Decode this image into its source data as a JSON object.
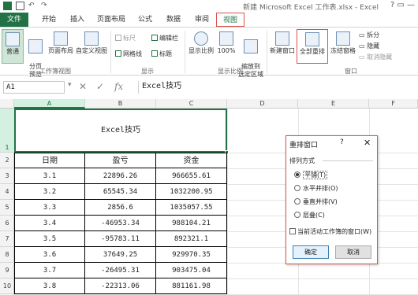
{
  "app": {
    "window_title": "新建 Microsoft Excel 工作表.xlsx - Excel",
    "window_controls": "?  ▭  —"
  },
  "tabs": [
    "文件",
    "开始",
    "插入",
    "页面布局",
    "公式",
    "数据",
    "审阅",
    "视图"
  ],
  "ribbon": {
    "workbook_views": {
      "normal": "普通",
      "page_break": "分页\n预览",
      "page_layout": "页面布局",
      "custom_views": "自定义视图",
      "label": "工作簿视图"
    },
    "show": {
      "ruler": "标尺",
      "formula_bar": "编辑栏",
      "gridlines": "网格线",
      "headings": "标题",
      "label": "显示"
    },
    "zoom": {
      "zoom": "显示比例",
      "zoom100": "100%",
      "zoom_selection": "缩放到\n选定区域",
      "label": "显示比例"
    },
    "window": {
      "new_window": "新建窗口",
      "arrange_all": "全部重排",
      "freeze_panes": "冻结窗格",
      "split": "拆分",
      "hide": "隐藏",
      "unhide": "取消隐藏",
      "label": "窗口"
    }
  },
  "formula_bar": {
    "name_box": "A1",
    "fx": "fx",
    "value": "Excel技巧"
  },
  "grid": {
    "columns": [
      "A",
      "B",
      "C",
      "D",
      "E",
      "F"
    ],
    "rows": [
      "1",
      "2",
      "3",
      "4",
      "5",
      "6",
      "7",
      "8",
      "9",
      "10"
    ],
    "title_cell": "Excel技巧",
    "headers": [
      "日期",
      "盈亏",
      "资金"
    ],
    "data": [
      [
        "3.1",
        "22896.26",
        "966655.61"
      ],
      [
        "3.2",
        "65545.34",
        "1032200.95"
      ],
      [
        "3.3",
        "2856.6",
        "1035057.55"
      ],
      [
        "3.4",
        "-46953.34",
        "988104.21"
      ],
      [
        "3.5",
        "-95783.11",
        "892321.1"
      ],
      [
        "3.6",
        "37649.25",
        "929970.35"
      ],
      [
        "3.7",
        "-26495.31",
        "903475.04"
      ],
      [
        "3.8",
        "-22313.06",
        "881161.98"
      ]
    ]
  },
  "dialog": {
    "title": "重排窗口",
    "help": "?",
    "close": "✕",
    "section": "排列方式",
    "options": [
      "平铺(T)",
      "水平并排(O)",
      "垂直并排(V)",
      "层叠(C)"
    ],
    "selected_index": 0,
    "checkbox_label": "当前活动工作簿的窗口(W)",
    "ok": "确定",
    "cancel": "取消"
  },
  "colors": {
    "accent": "#217346",
    "highlight": "#d9534f"
  }
}
